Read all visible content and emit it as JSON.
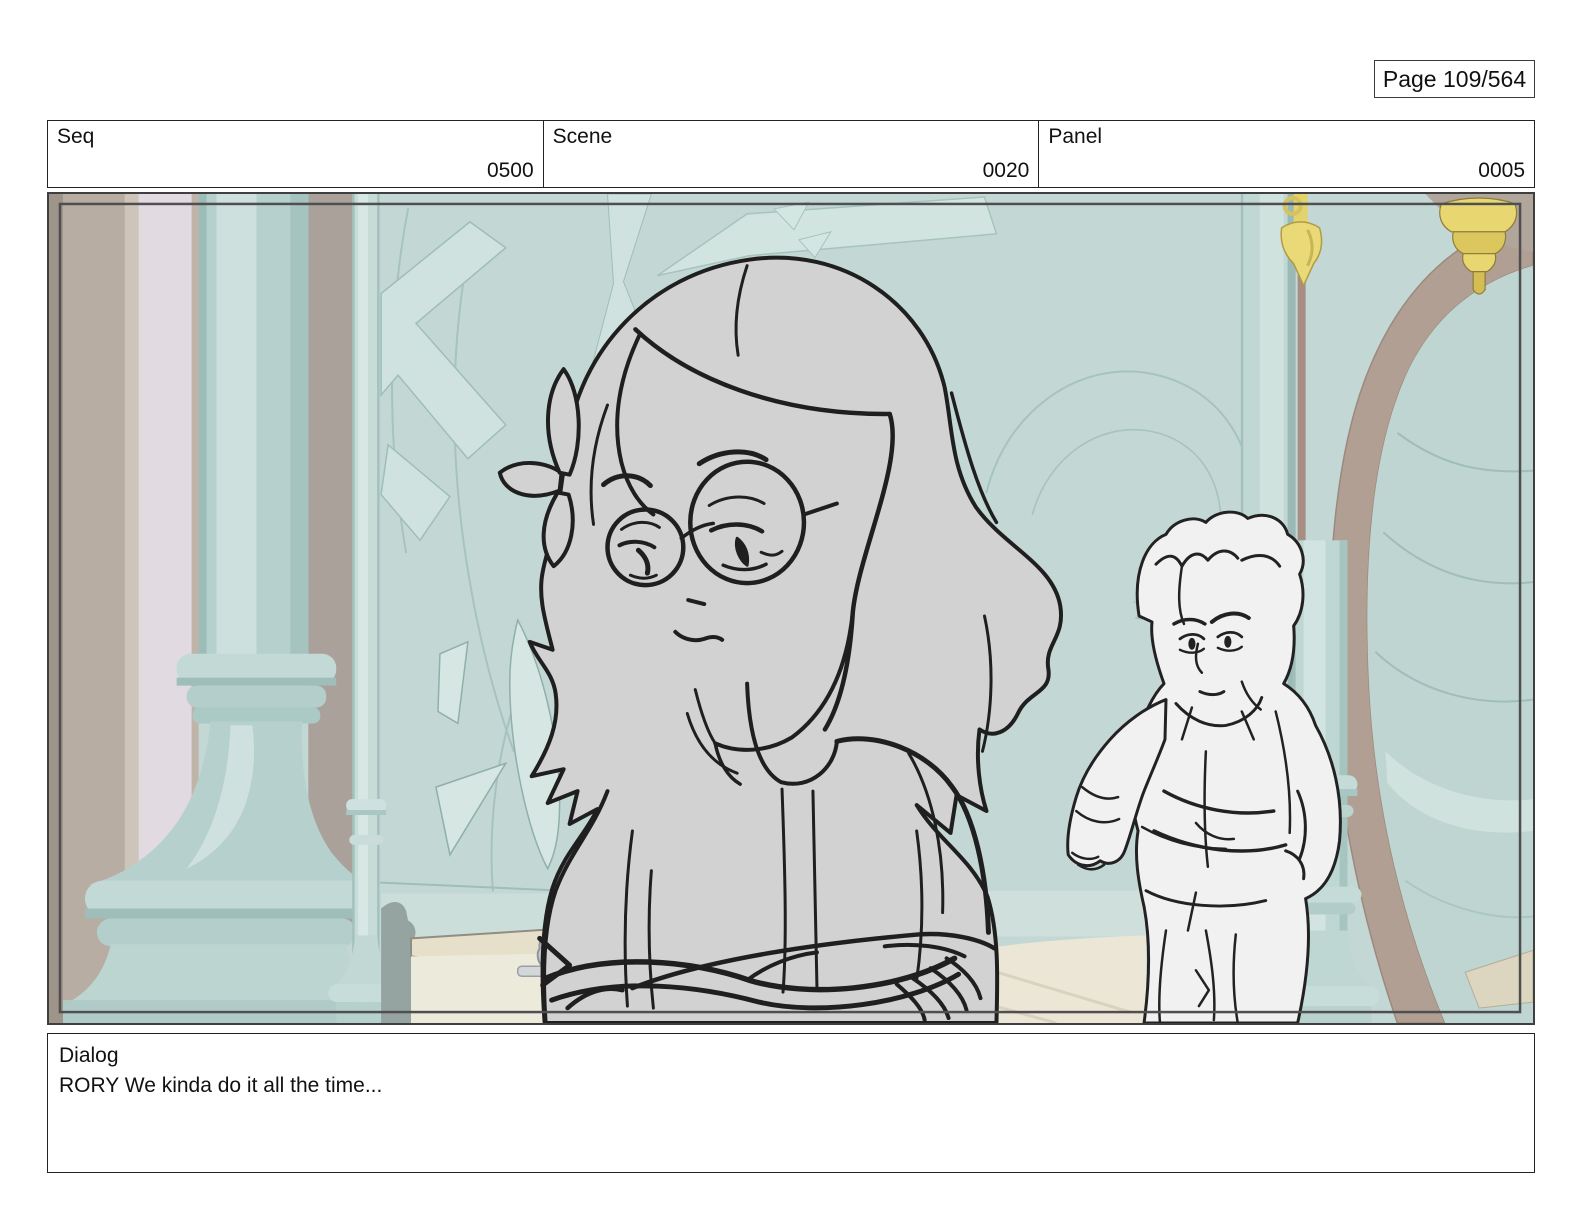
{
  "page": {
    "indicator": "Page 109/564"
  },
  "header": {
    "cells": [
      {
        "label": "Seq",
        "value": "0500"
      },
      {
        "label": "Scene",
        "value": "0020"
      },
      {
        "label": "Panel",
        "value": "0005"
      }
    ]
  },
  "dialog": {
    "label": "Dialog",
    "text": "RORY We kinda do it all the time..."
  },
  "panel": {
    "description": "Storyboard sketch: sad girl with round glasses and a flower hair clip, arms crossed in the foreground; a concerned curly-haired boy standing behind her with crossed arms, inside a pale teal clock-tower interior with ornate columns, gold fixtures and a cream table."
  },
  "palette": {
    "wall_teal": "#c3d8d4",
    "pattern_teal_light": "#d2e4e0",
    "pattern_line": "#9fbdb9",
    "column_teal": "#b6d1cd",
    "column_highlight": "#cfe1de",
    "lavender_band": "#e1dae1",
    "taupe_band": "#b7ada2",
    "brown_arc": "#b29f93",
    "gold_accent": "#e8d671",
    "girl_fill": "#d2d2d2",
    "boy_fill": "#f0f1f0",
    "sketch_line": "#1f1f1f",
    "table_cream": "#e6e0ca"
  }
}
